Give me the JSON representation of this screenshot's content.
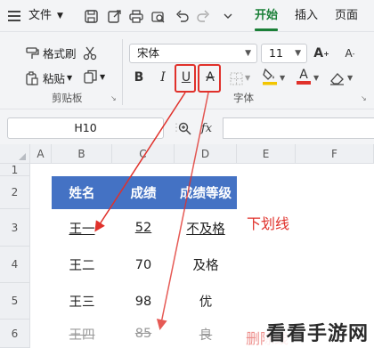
{
  "menubar": {
    "file_label": "文件",
    "tabs": [
      {
        "label": "开始",
        "active": true
      },
      {
        "label": "插入",
        "active": false
      },
      {
        "label": "页面",
        "active": false
      }
    ],
    "icons": [
      "menu-icon",
      "save-icon",
      "export-icon",
      "print-icon",
      "print-preview-icon",
      "undo-icon",
      "redo-icon",
      "more-icon"
    ]
  },
  "ribbon": {
    "clipboard": {
      "format_painter": "格式刷",
      "paste": "粘贴",
      "group_label": "剪贴板"
    },
    "font": {
      "font_name": "宋体",
      "font_size": "11",
      "group_label": "字体",
      "buttons": {
        "bold": "B",
        "italic": "I",
        "underline": "U",
        "strikethrough": "A",
        "font_color": "A"
      }
    },
    "colors": {
      "highlight_underline": "#f2c500",
      "font_color_underline": "#e0312b",
      "active_tab": "#1a7f37",
      "annotation": "#e0312b"
    }
  },
  "formula_bar": {
    "cell_reference": "H10",
    "fx_label": "fx"
  },
  "grid": {
    "columns": [
      "A",
      "B",
      "C",
      "D",
      "E",
      "F"
    ],
    "rows": [
      "1",
      "2",
      "3",
      "4",
      "5",
      "6"
    ],
    "table": {
      "headers": [
        "姓名",
        "成绩",
        "成绩等级"
      ],
      "rows": [
        [
          "王一",
          "52",
          "不及格"
        ],
        [
          "王二",
          "70",
          "及格"
        ],
        [
          "王三",
          "98",
          "优"
        ],
        [
          "王四",
          "85",
          "良"
        ]
      ],
      "header_color": "#4472c4"
    }
  },
  "annotations": {
    "underline_label": "下划线",
    "strikethrough_label": "删除线"
  },
  "watermark": "看看手游网"
}
